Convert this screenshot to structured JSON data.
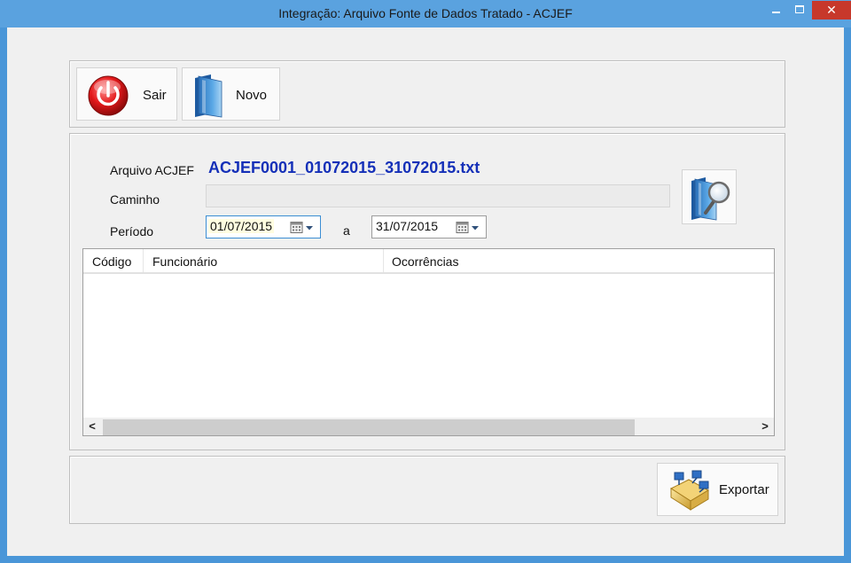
{
  "window": {
    "title": "Integração: Arquivo Fonte de Dados Tratado - ACJEF",
    "controls": {
      "minimize": "",
      "maximize": "",
      "close": "✕"
    }
  },
  "toolbar": {
    "sair_label": "Sair",
    "novo_label": "Novo",
    "sair_icon": "power-icon",
    "novo_icon": "folder-icon"
  },
  "form": {
    "arquivo_label": "Arquivo ACJEF",
    "arquivo_value": "ACJEF0001_01072015_31072015.txt",
    "caminho_label": "Caminho",
    "caminho_value": "",
    "periodo_label": "Período",
    "date_from": "01/07/2015",
    "separator": "a",
    "date_to": "31/07/2015",
    "search_icon": "folder-search-icon"
  },
  "grid": {
    "columns": [
      "Código",
      "Funcionário",
      "Ocorrências"
    ],
    "rows": []
  },
  "footer": {
    "exportar_label": "Exportar",
    "exportar_icon": "export-icon"
  },
  "colors": {
    "titlebar": "#5aa2df",
    "close_button": "#c7382b",
    "filename_text": "#1530b8"
  }
}
